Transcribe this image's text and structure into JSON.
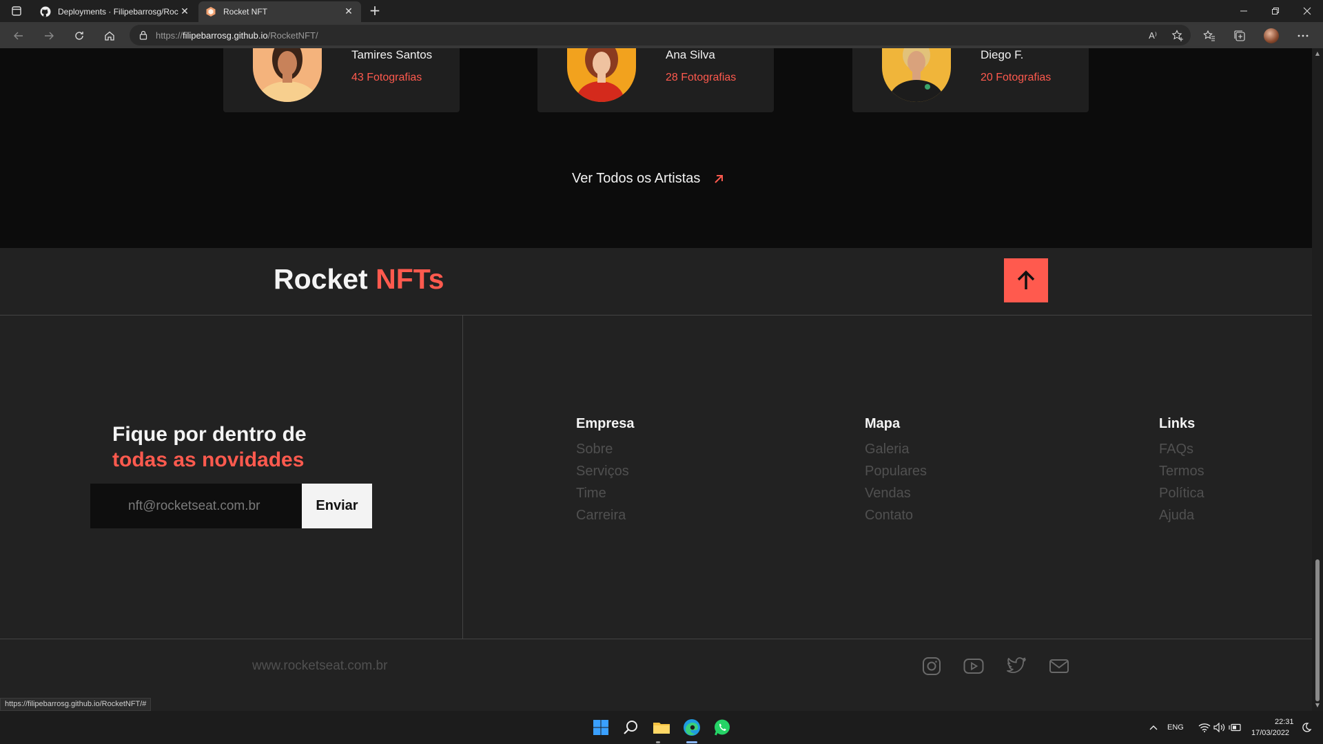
{
  "browser": {
    "tabs": [
      {
        "title": "Deployments · Filipebarrosg/Roc",
        "icon": "github-icon"
      },
      {
        "title": "Rocket NFT",
        "icon": "rocket-nft-favicon"
      }
    ],
    "url_prefix": "https://",
    "url_host": "filipebarrosg.github.io",
    "url_path": "/RocketNFT/",
    "read_aloud_label": "A⁾"
  },
  "artists": [
    {
      "name": "Tamires Santos",
      "photos": "43 Fotografias",
      "avatar_color": "#f3a46a"
    },
    {
      "name": "Ana Silva",
      "photos": "28 Fotografias",
      "avatar_color": "#f0a020"
    },
    {
      "name": "Diego F.",
      "photos": "20 Fotografias",
      "avatar_color": "#f2b233"
    }
  ],
  "see_all": {
    "label": "Ver Todos os Artistas"
  },
  "footer": {
    "brand_main": "Rocket",
    "brand_accent": "NFTs",
    "newsletter": {
      "title_line1": "Fique por dentro de",
      "title_line2": "todas as novidades",
      "placeholder": "nft@rocketseat.com.br",
      "submit_label": "Enviar"
    },
    "columns": [
      {
        "title": "Empresa",
        "items": [
          "Sobre",
          "Serviços",
          "Time",
          "Carreira"
        ]
      },
      {
        "title": "Mapa",
        "items": [
          "Galeria",
          "Populares",
          "Vendas",
          "Contato"
        ]
      },
      {
        "title": "Links",
        "items": [
          "FAQs",
          "Termos",
          "Política",
          "Ajuda"
        ]
      }
    ],
    "site_url": "www.rocketseat.com.br",
    "social": [
      "instagram-icon",
      "youtube-icon",
      "twitter-icon",
      "mail-icon"
    ]
  },
  "status_bar_url": "https://filipebarrosg.github.io/RocketNFT/#",
  "taskbar": {
    "language": "ENG",
    "time": "22:31",
    "date": "17/03/2022"
  },
  "colors": {
    "accent": "#ff5a4e",
    "background": "#0c0c0c",
    "footer_bg": "#222222"
  }
}
